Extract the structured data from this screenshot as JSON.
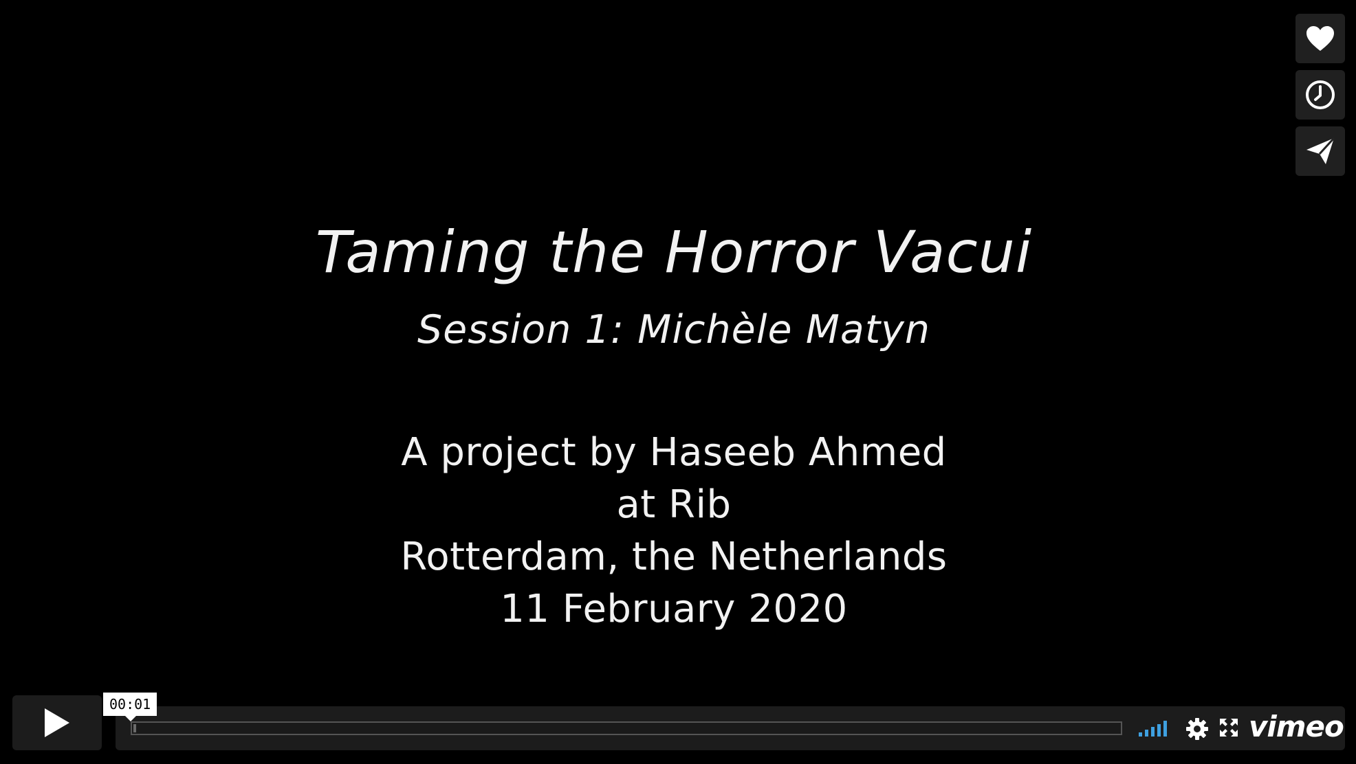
{
  "video": {
    "title": "Taming the Horror Vacui",
    "session": "Session 1: Michèle Matyn",
    "credits": [
      "A project by Haseeb Ahmed",
      "at Rib",
      "Rotterdam, the Netherlands",
      "11 February 2020"
    ]
  },
  "side_buttons": [
    "heart-icon",
    "clock-icon",
    "paper-plane-icon"
  ],
  "controls": {
    "time_tooltip": "00:01",
    "progress_fraction": 0.003,
    "brand": "vimeo",
    "volume_color": "#3ea0e0"
  }
}
